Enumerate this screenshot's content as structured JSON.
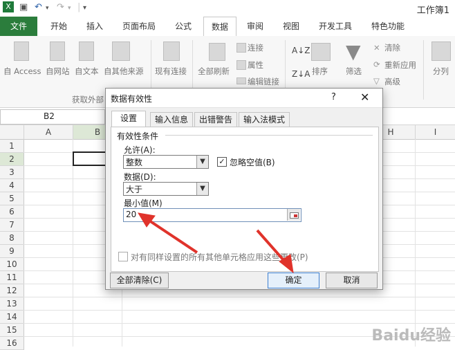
{
  "window": {
    "title": "工作簿1"
  },
  "tabs": [
    "文件",
    "开始",
    "插入",
    "页面布局",
    "公式",
    "数据",
    "审阅",
    "视图",
    "开发工具",
    "特色功能"
  ],
  "ribbon": {
    "get_external": [
      "自 Access",
      "自网站",
      "自文本",
      "自其他来源"
    ],
    "existing": "现有连接",
    "group_label": "获取外部",
    "refresh_all": "全部刷新",
    "connections": "连接",
    "properties": "属性",
    "edit_links": "编辑链接",
    "sort": "排序",
    "filter": "筛选",
    "clear": "清除",
    "reapply": "重新应用",
    "advanced": "高级",
    "split": "分列"
  },
  "formula_bar": {
    "name_box": "B2"
  },
  "grid": {
    "columns": [
      "A",
      "B",
      "",
      "",
      "",
      "",
      "",
      "H",
      "I"
    ],
    "rows": [
      "1",
      "2",
      "3",
      "4",
      "5",
      "6",
      "7",
      "8",
      "9",
      "10",
      "11",
      "12",
      "13",
      "14",
      "15",
      "16"
    ]
  },
  "dialog": {
    "title": "数据有效性",
    "help": "?",
    "tabs": [
      "设置",
      "输入信息",
      "出错警告",
      "输入法模式"
    ],
    "section": "有效性条件",
    "allow_label": "允许(A):",
    "allow_value": "整数",
    "ignore_blank": "忽略空值(B)",
    "data_label": "数据(D):",
    "data_value": "大于",
    "min_label": "最小值(M)",
    "min_value": "20",
    "apply_all": "对有同样设置的所有其他单元格应用这些更改(P)",
    "clear_all": "全部清除(C)",
    "ok": "确定",
    "cancel": "取消"
  },
  "watermark": "Baidu经验"
}
